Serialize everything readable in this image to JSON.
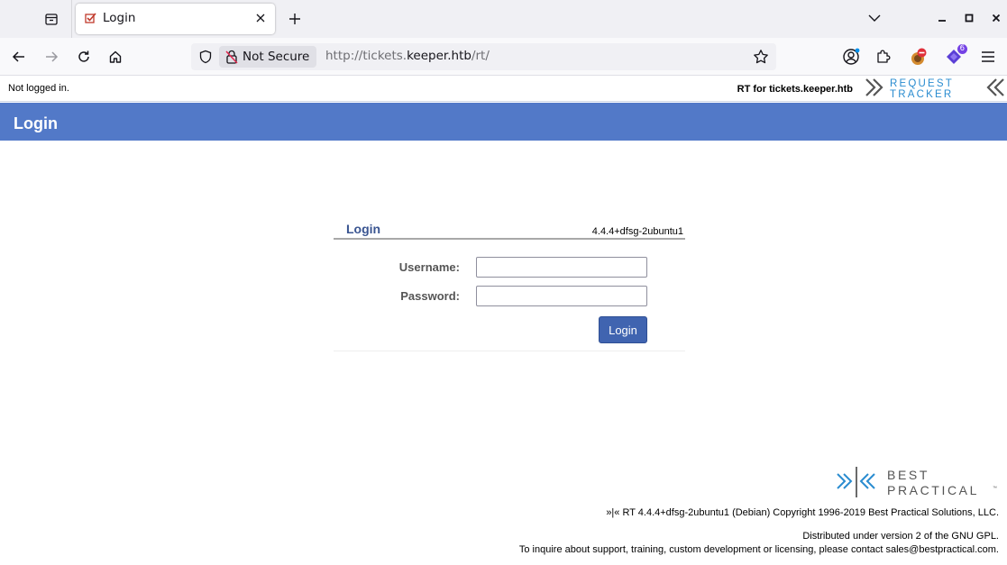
{
  "browser": {
    "tab": {
      "title": "Login"
    },
    "urlbar": {
      "security_label": "Not Secure",
      "url_prefix": "http://tickets.",
      "url_host": "keeper.htb",
      "url_path": "/rt/"
    },
    "extension_badge": "6"
  },
  "page": {
    "status_text": "Not logged in.",
    "rt_for": "RT for tickets.keeper.htb",
    "logo_text": {
      "line1": "REQUEST",
      "line2": "TRACKER"
    },
    "header_title": "Login",
    "login_box": {
      "title": "Login",
      "version": "4.4.4+dfsg-2ubuntu1",
      "username_label": "Username:",
      "password_label": "Password:",
      "username_value": "",
      "password_value": "",
      "submit_label": "Login"
    },
    "footer": {
      "logo_text": {
        "line1": "BEST",
        "line2": "PRACTICAL",
        "tm": "™"
      },
      "copyright": "»|« RT 4.4.4+dfsg-2ubuntu1 (Debian) Copyright 1996-2019 Best Practical Solutions, LLC.",
      "license": "Distributed under version 2 of the GNU GPL.",
      "contact": "To inquire about support, training, custom development or licensing, please contact sales@bestpractical.com."
    }
  },
  "colors": {
    "header_blue": "#5279c8",
    "button_blue": "#4064b0",
    "logo_blue": "#2a8cd0"
  }
}
